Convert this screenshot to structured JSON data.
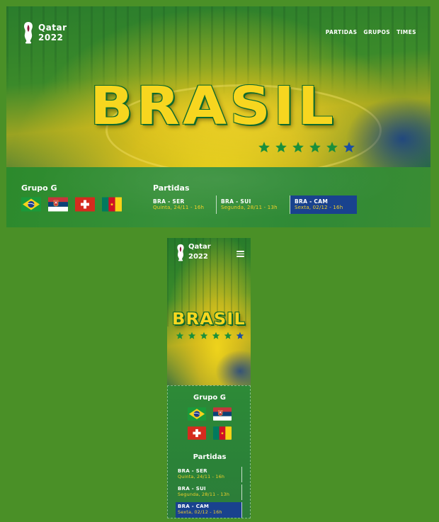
{
  "brand": {
    "name_line1": "Qatar",
    "name_line2": "2022"
  },
  "nav": {
    "items": [
      "PARTIDAS",
      "GRUPOS",
      "TIMES"
    ]
  },
  "hero": {
    "title": "BRASIL",
    "star_count": 6,
    "star_colors": [
      "#1a8f3b",
      "#1a8f3b",
      "#1a8f3b",
      "#1a8f3b",
      "#1a8f3b",
      "#1a4fa3"
    ]
  },
  "group": {
    "title": "Grupo G",
    "flags": [
      "brazil-flag",
      "serbia-flag",
      "switzerland-flag",
      "cameroon-flag"
    ]
  },
  "matches": {
    "title": "Partidas",
    "items": [
      {
        "teams": "BRA - SER",
        "date": "Quinta, 24/11 - 16h",
        "highlighted": false
      },
      {
        "teams": "BRA - SUI",
        "date": "Segunda, 28/11 - 13h",
        "highlighted": false
      },
      {
        "teams": "BRA - CAM",
        "date": "Sexta, 02/12 - 16h",
        "highlighted": true
      }
    ]
  },
  "mobile_menu": {
    "icon": "hamburger-menu-icon"
  },
  "colors": {
    "page_background": "#4a9027",
    "title_yellow": "#f7d61f",
    "date_yellow": "#f3d02a",
    "highlight_blue": "#19428e",
    "brazil_green": "#1a8f3b"
  }
}
